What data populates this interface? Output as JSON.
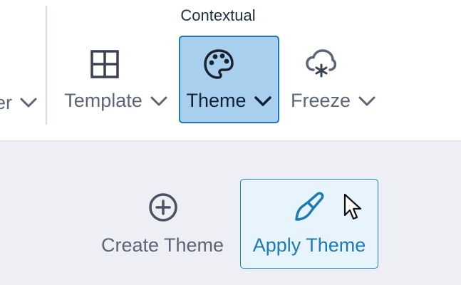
{
  "ribbon": {
    "group_title": "Contextual",
    "partial_label": "er",
    "buttons": {
      "template": {
        "label": "Template",
        "icon": "grid-icon"
      },
      "theme": {
        "label": "Theme",
        "icon": "palette-icon",
        "active": true
      },
      "freeze": {
        "label": "Freeze",
        "icon": "snow-cloud-icon"
      }
    }
  },
  "panel": {
    "create_theme": {
      "label": "Create Theme",
      "icon": "plus-circle-icon"
    },
    "apply_theme": {
      "label": "Apply Theme",
      "icon": "paintbrush-icon",
      "hovered": true
    }
  },
  "colors": {
    "accent": "#1f79bf",
    "active_bg": "#a8d0ee",
    "hover_bg": "#e8f4fb",
    "icon_dark": "#3a4150",
    "icon_blue": "#1a7bb8",
    "panel_bg": "#edeff4"
  }
}
